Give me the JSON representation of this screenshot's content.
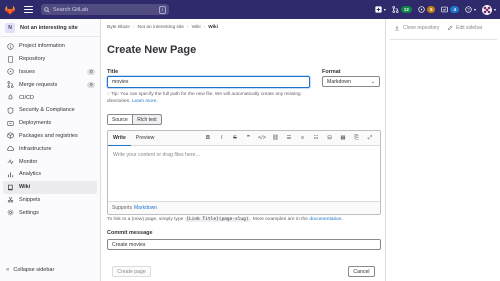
{
  "topbar": {
    "search_placeholder": "Search GitLab",
    "search_shortcut": "/",
    "counts": {
      "merge_requests": "12",
      "issues": "6",
      "todos": "4"
    },
    "colors": {
      "bg": "#2f2a6b",
      "green": "#108548",
      "orange": "#c17d10",
      "blue": "#1f75cb"
    }
  },
  "sidebar": {
    "project_initial": "N",
    "project_name": "Not an interesting site",
    "items": [
      {
        "label": "Project information",
        "icon": "info-icon"
      },
      {
        "label": "Repository",
        "icon": "repository-icon"
      },
      {
        "label": "Issues",
        "icon": "issues-icon",
        "count": "0"
      },
      {
        "label": "Merge requests",
        "icon": "merge-request-icon",
        "count": "0"
      },
      {
        "label": "CI/CD",
        "icon": "rocket-icon"
      },
      {
        "label": "Security & Compliance",
        "icon": "shield-icon"
      },
      {
        "label": "Deployments",
        "icon": "deployments-icon"
      },
      {
        "label": "Packages and registries",
        "icon": "package-icon"
      },
      {
        "label": "Infrastructure",
        "icon": "cloud-icon"
      },
      {
        "label": "Monitor",
        "icon": "monitor-icon"
      },
      {
        "label": "Analytics",
        "icon": "chart-icon"
      },
      {
        "label": "Wiki",
        "icon": "book-icon"
      },
      {
        "label": "Snippets",
        "icon": "snippet-icon"
      },
      {
        "label": "Settings",
        "icon": "gear-icon"
      }
    ],
    "collapse_label": "Collapse sidebar"
  },
  "breadcrumbs": [
    "Byte Blaze",
    "Not an interesting site",
    "Wiki",
    "Wiki"
  ],
  "page": {
    "title": "Create New Page",
    "title_label": "Title",
    "title_value": "movies",
    "format_label": "Format",
    "format_value": "Markdown",
    "tip_text": "Tip: You can specify the full path for the new file. We will automatically create any missing directories.",
    "tip_link": "Learn more.",
    "mode_source": "Source",
    "mode_rich": "Rich text",
    "tab_write": "Write",
    "tab_preview": "Preview",
    "editor_placeholder": "Write your content or drag files here…",
    "supports_text": "Supports",
    "supports_link": "Markdown",
    "hint_pre": "To link to a (new) page, simply type",
    "hint_code": "[Link Title](page-slug)",
    "hint_mid": ". More examples are in the",
    "hint_link": "documentation",
    "hint_end": ".",
    "commit_label": "Commit message",
    "commit_value": "Create movies",
    "create_button": "Create page",
    "cancel_button": "Cancel"
  },
  "right_panel": {
    "clone": "Clone repository",
    "edit_sidebar": "Edit sidebar"
  }
}
